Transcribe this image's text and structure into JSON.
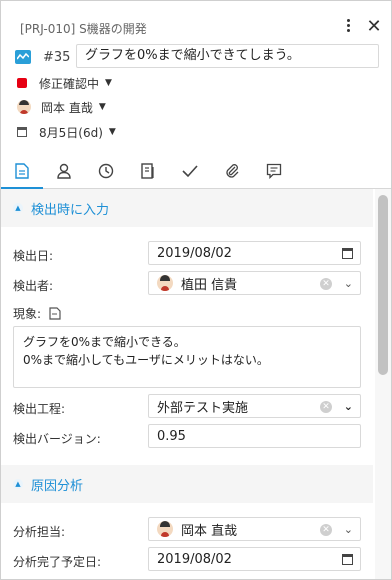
{
  "header": {
    "project": "[PRJ-010] S機器の開発",
    "ticket_no": "#35",
    "title": "グラフを0%まで縮小できてしまう。",
    "status": "修正確認中",
    "status_color": "#e60012",
    "assignee": "岡本 直哉",
    "due": "8月5日(6d)"
  },
  "tabs": [
    {
      "icon": "document-icon"
    },
    {
      "icon": "person-icon"
    },
    {
      "icon": "clock-icon"
    },
    {
      "icon": "checklist-icon"
    },
    {
      "icon": "check-icon"
    },
    {
      "icon": "attachment-icon"
    },
    {
      "icon": "comment-icon"
    }
  ],
  "accent": "#1e90d6",
  "section_detect": {
    "title": "検出時に入力",
    "detect_date_label": "検出日:",
    "detect_date": "2019/08/02",
    "detector_label": "検出者:",
    "detector": "植田 信貴",
    "phenomenon_label": "現象:",
    "phenomenon": "グラフを0%まで縮小できる。\n0%まで縮小してもユーザにメリットはない。",
    "process_label": "検出工程:",
    "process": "外部テスト実施",
    "version_label": "検出バージョン:",
    "version": "0.95"
  },
  "section_cause": {
    "title": "原因分析",
    "analyst_label": "分析担当:",
    "analyst": "岡本 直哉",
    "due_label": "分析完了予定日:",
    "due": "2019/08/02"
  }
}
